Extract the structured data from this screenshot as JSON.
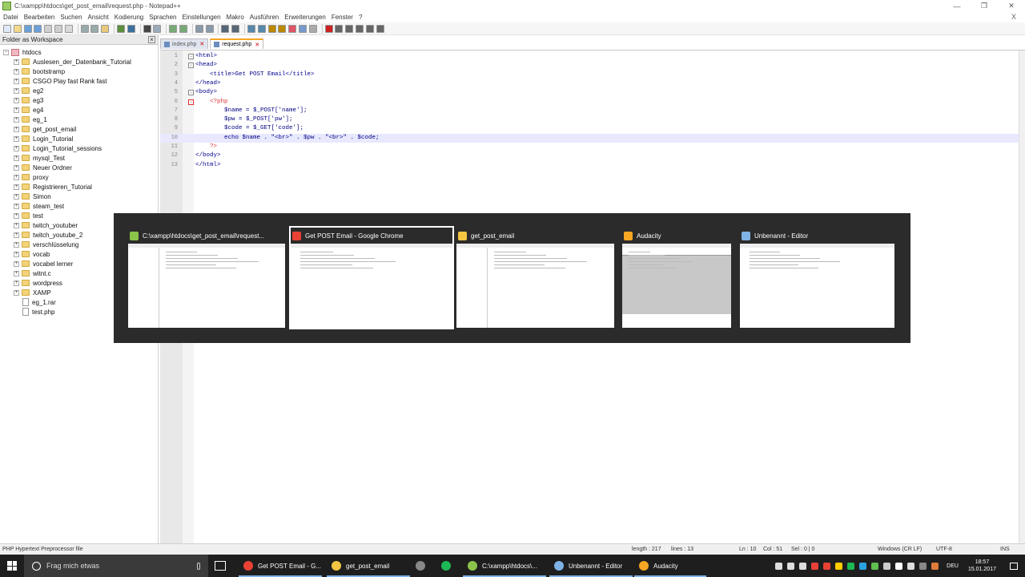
{
  "window": {
    "title": "C:\\xampp\\htdocs\\get_post_email\\request.php - Notepad++",
    "controls": [
      "—",
      "❐",
      "✕"
    ]
  },
  "menu": [
    "Datei",
    "Bearbeiten",
    "Suchen",
    "Ansicht",
    "Kodierung",
    "Sprachen",
    "Einstellungen",
    "Makro",
    "Ausführen",
    "Erweiterungen",
    "Fenster",
    "?"
  ],
  "menu_close": "X",
  "sidebar": {
    "title": "Folder as Workspace",
    "close": "×",
    "root": "htdocs",
    "folders": [
      "Auslesen_der_Datenbank_Tutorial",
      "bootstramp",
      "CSGO Play fast Rank fast",
      "eg2",
      "eg3",
      "eg4",
      "eg_1",
      "get_post_email",
      "Login_Tutorial",
      "Login_Tutorial_sessions",
      "mysql_Test",
      "Neuer Ordner",
      "proxy",
      "Registrieren_Tutorial",
      "Simon",
      "steam_test",
      "test",
      "twitch_youtuber",
      "twitch_youtube_2",
      "verschlüsselung",
      "vocab",
      "vocabel lerner",
      "witnt.c",
      "wordpress",
      "XAMP"
    ],
    "files": [
      "eg_1.rar",
      "test.php"
    ]
  },
  "tabs": [
    {
      "label": "index.php",
      "active": false
    },
    {
      "label": "request.php",
      "active": true
    }
  ],
  "code_lines": [
    {
      "n": "1",
      "text": "<html>"
    },
    {
      "n": "2",
      "text": "<head>"
    },
    {
      "n": "3",
      "text": "    <title>Get POST Email</title>"
    },
    {
      "n": "4",
      "text": "</head>"
    },
    {
      "n": "5",
      "text": "<body>"
    },
    {
      "n": "6",
      "text": "    <?php"
    },
    {
      "n": "7",
      "text": "        $name = $_POST['name'];"
    },
    {
      "n": "8",
      "text": "        $pw = $_POST['pw'];"
    },
    {
      "n": "9",
      "text": "        $code = $_GET['code'];"
    },
    {
      "n": "10",
      "text": "        echo $name . \"<br>\" . $pw . \"<br>\" . $code;"
    },
    {
      "n": "11",
      "text": "    ?>"
    },
    {
      "n": "12",
      "text": "</body>"
    },
    {
      "n": "13",
      "text": "</html>"
    }
  ],
  "status": {
    "filetype": "PHP Hypertext Preprocessor file",
    "length": "length : 217",
    "lines": "lines : 13",
    "ln": "Ln : 10",
    "col": "Col : 51",
    "sel": "Sel : 0 | 0",
    "eol": "Windows (CR LF)",
    "encoding": "UTF-8",
    "mode": "INS"
  },
  "switcher": {
    "items": [
      {
        "title": "C:\\xampp\\htdocs\\get_post_email\\request...",
        "icon_color": "#8bc34a",
        "selected": false
      },
      {
        "title": "Get POST Email - Google Chrome",
        "icon_color": "#e94235",
        "selected": true
      },
      {
        "title": "get_post_email",
        "icon_color": "#f4c542",
        "selected": false
      },
      {
        "title": "Audacity",
        "icon_color": "#f5a623",
        "selected": false
      },
      {
        "title": "Unbenannt - Editor",
        "icon_color": "#7fb2e5",
        "selected": false
      }
    ]
  },
  "taskbar": {
    "search_placeholder": "Frag mich etwas",
    "items": [
      {
        "label": "Get POST Email - G...",
        "icon_color": "#e94235"
      },
      {
        "label": "get_post_email",
        "icon_color": "#f4c542"
      },
      {
        "label": "",
        "icon_color": "#888888"
      },
      {
        "label": "",
        "icon_color": "#1db954"
      },
      {
        "label": "C:\\xampp\\htdocs\\...",
        "icon_color": "#8bc34a"
      },
      {
        "label": "Unbenannt - Editor",
        "icon_color": "#7fb2e5"
      },
      {
        "label": "Audacity",
        "icon_color": "#f5a623"
      }
    ],
    "lang": "DEU",
    "time": "18:57",
    "date": "15.01.2017"
  }
}
